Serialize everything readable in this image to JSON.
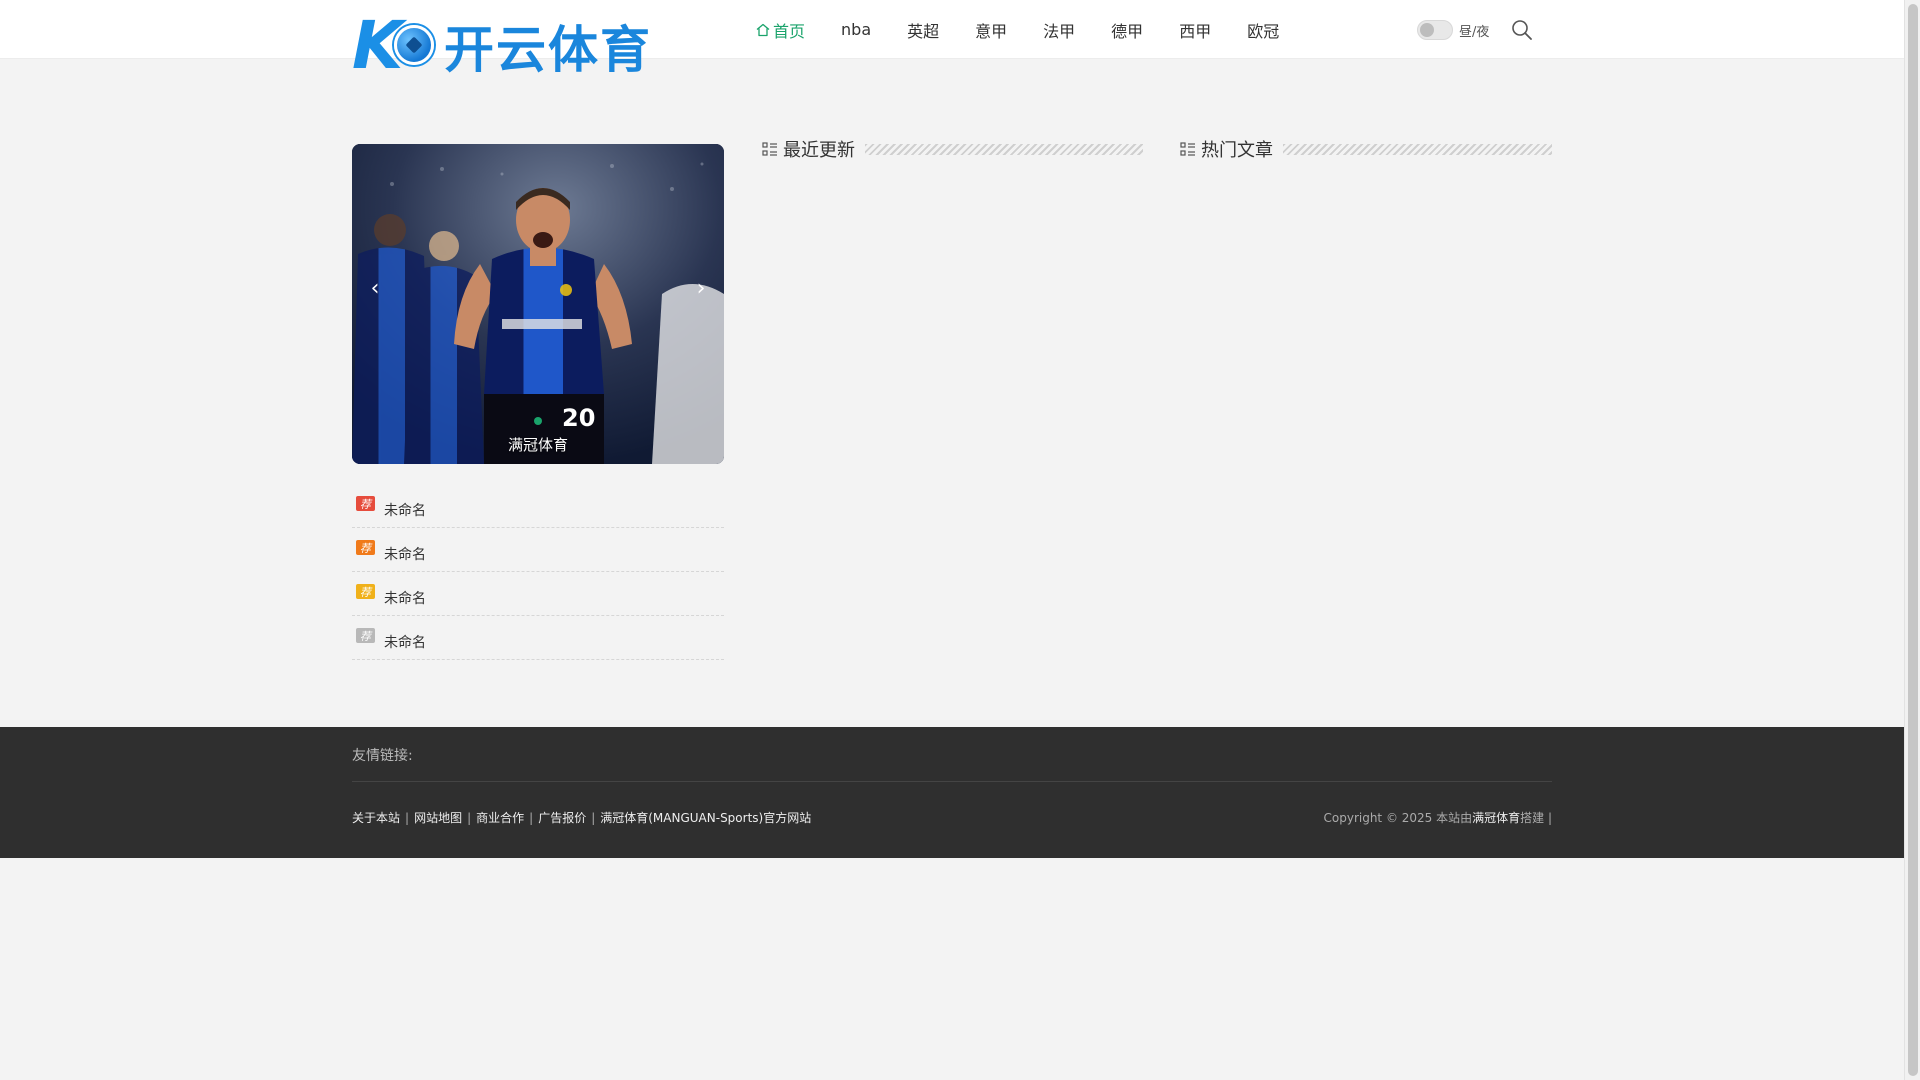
{
  "header": {
    "logo_text": "开云体育",
    "nav": [
      {
        "label": "首页",
        "active": true
      },
      {
        "label": "nba"
      },
      {
        "label": "英超"
      },
      {
        "label": "意甲"
      },
      {
        "label": "法甲"
      },
      {
        "label": "德甲"
      },
      {
        "label": "西甲"
      },
      {
        "label": "欧冠"
      }
    ],
    "theme_toggle_label": "昼/夜"
  },
  "slider": {
    "caption": "满冠体育",
    "prev_icon": "‹",
    "next_icon": "›",
    "jersey_number": "20"
  },
  "recommended": [
    {
      "badge": "荐",
      "title": "未命名",
      "badge_color": "#e64c3c"
    },
    {
      "badge": "荐",
      "title": "未命名",
      "badge_color": "#f07a1a"
    },
    {
      "badge": "荐",
      "title": "未命名",
      "badge_color": "#f0b11a"
    },
    {
      "badge": "荐",
      "title": "未命名",
      "badge_color": "#b8b8b8"
    }
  ],
  "sections": {
    "recent_title": "最近更新",
    "hot_title": "热门文章"
  },
  "footer": {
    "friend_links_label": "友情链接:",
    "links": [
      "关于本站",
      "网站地图",
      "商业合作",
      "广告报价",
      "满冠体育(MANGUAN-Sports)官方网站"
    ],
    "separator": "|",
    "copyright_prefix": "Copyright © 2025 本站由",
    "copyright_brand": "满冠体育",
    "copyright_suffix": "搭建 |"
  },
  "colors": {
    "accent": "#1aa36b",
    "footer_bg": "#2f2f2f",
    "logo_blue": "#1a86dc"
  }
}
